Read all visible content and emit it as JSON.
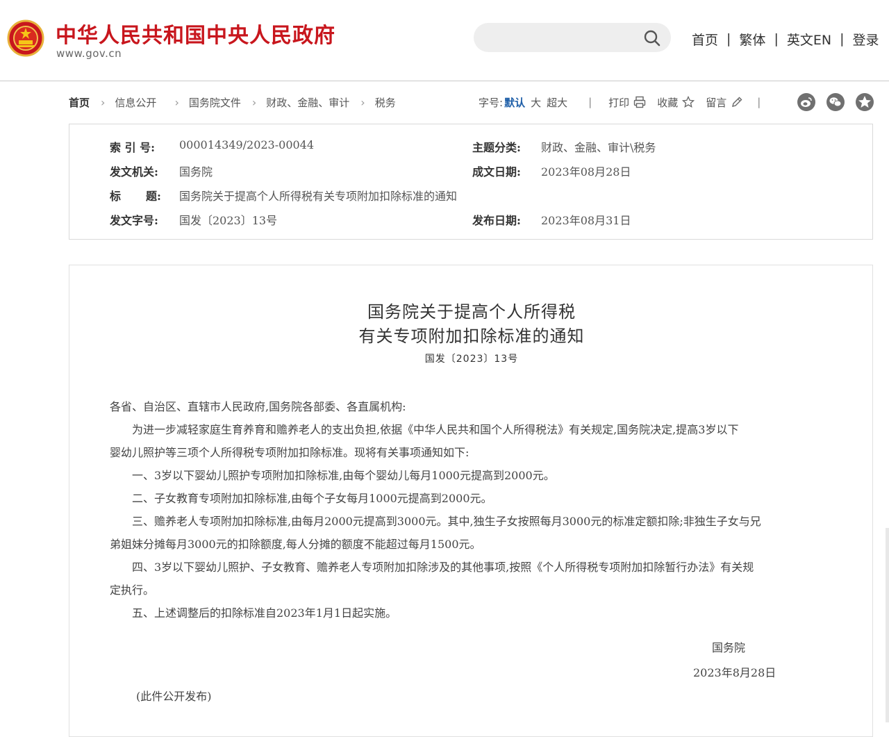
{
  "header": {
    "site_title": "中华人民共和国中央人民政府",
    "site_url": "www.gov.cn",
    "search_placeholder": "",
    "links": [
      "首页",
      "繁体",
      "英文EN",
      "登录"
    ]
  },
  "breadcrumb": [
    "首页",
    "信息公开",
    "国务院文件",
    "财政、金融、审计",
    "税务"
  ],
  "tools": {
    "font_size_label": "字号:",
    "font_default": "默认",
    "font_large": "大",
    "font_xlarge": "超大",
    "print": "打印",
    "favorite": "收藏",
    "comment": "留言"
  },
  "info": {
    "index_label": "索 引 号:",
    "index_value": "000014349/2023-00044",
    "topic_label": "主题分类:",
    "topic_value": "财政、金融、审计\\税务",
    "issuer_label": "发文机关:",
    "issuer_value": "国务院",
    "written_label": "成文日期:",
    "written_value": "2023年08月28日",
    "title_label_a": "标",
    "title_label_b": "题:",
    "title_value": "国务院关于提高个人所得税有关专项附加扣除标准的通知",
    "docno_label": "发文字号:",
    "docno_value": "国发〔2023〕13号",
    "published_label": "发布日期:",
    "published_value": "2023年08月31日"
  },
  "article": {
    "title_line1": "国务院关于提高个人所得税",
    "title_line2": "有关专项附加扣除标准的通知",
    "doc_no": "国发〔2023〕13号",
    "salutation": "各省、自治区、直辖市人民政府,国务院各部委、各直属机构:",
    "p1_line1": "　　为进一步减轻家庭生育养育和赡养老人的支出负担,依据《中华人民共和国个人所得税法》有关规定,国务院决定,提高3岁以下",
    "p1_line2": "婴幼儿照护等三项个人所得税专项附加扣除标准。现将有关事项通知如下:",
    "item1": "　　一、3岁以下婴幼儿照护专项附加扣除标准,由每个婴幼儿每月1000元提高到2000元。",
    "item2": "　　二、子女教育专项附加扣除标准,由每个子女每月1000元提高到2000元。",
    "item3_line1": "　　三、赡养老人专项附加扣除标准,由每月2000元提高到3000元。其中,独生子女按照每月3000元的标准定额扣除;非独生子女与兄",
    "item3_line2": "弟姐妹分摊每月3000元的扣除额度,每人分摊的额度不能超过每月1500元。",
    "item4_line1": "　　四、3岁以下婴幼儿照护、子女教育、赡养老人专项附加扣除涉及的其他事项,按照《个人所得税专项附加扣除暂行办法》有关规",
    "item4_line2": "定执行。",
    "item5": "　　五、上述调整后的扣除标准自2023年1月1日起实施。",
    "signature": "国务院",
    "sign_date": "2023年8月28日",
    "note": "(此件公开发布)"
  },
  "colors": {
    "brand_red": "#c8161d",
    "link_blue": "#1f5fa8"
  },
  "icons": [
    "national-emblem-icon",
    "search-icon",
    "printer-icon",
    "star-icon",
    "pencil-icon",
    "weibo-icon",
    "wechat-icon",
    "qzone-icon"
  ]
}
